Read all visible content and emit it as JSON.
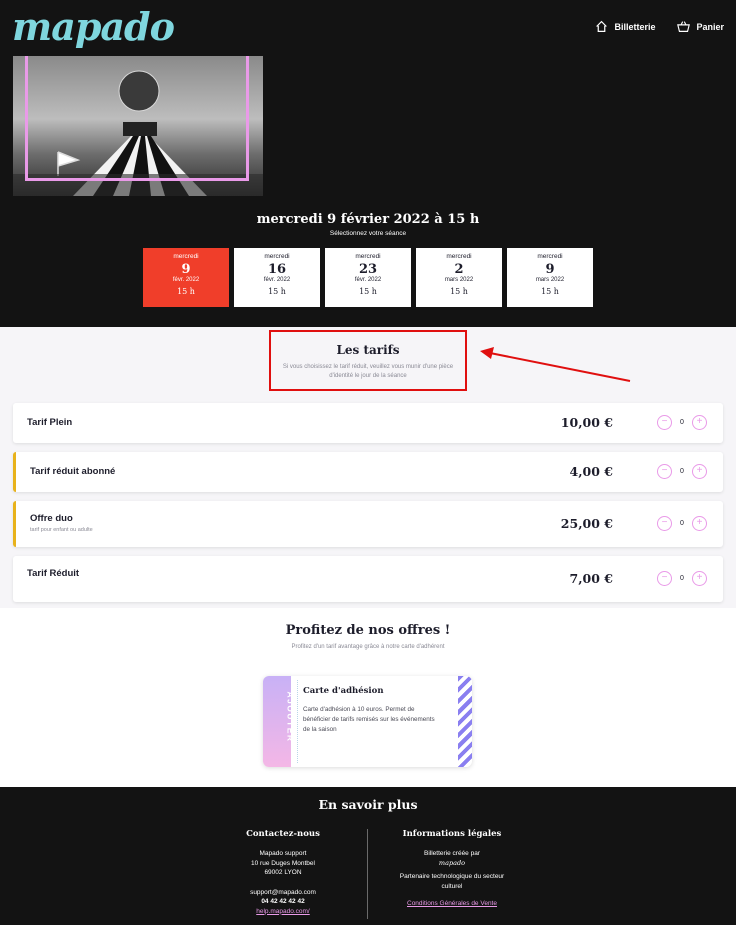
{
  "header": {
    "logo": "mapado",
    "nav": [
      {
        "label": "Billetterie",
        "icon": "home-icon"
      },
      {
        "label": "Panier",
        "icon": "basket-icon"
      }
    ]
  },
  "session": {
    "title": "mercredi 9 février 2022 à 15 h",
    "subtitle": "Sélectionnez votre séance",
    "dates": [
      {
        "dow": "mercredi",
        "day": "9",
        "month": "févr. 2022",
        "hour": "15 h",
        "active": true
      },
      {
        "dow": "mercredi",
        "day": "16",
        "month": "févr. 2022",
        "hour": "15 h",
        "active": false
      },
      {
        "dow": "mercredi",
        "day": "23",
        "month": "févr. 2022",
        "hour": "15 h",
        "active": false
      },
      {
        "dow": "mercredi",
        "day": "2",
        "month": "mars 2022",
        "hour": "15 h",
        "active": false
      },
      {
        "dow": "mercredi",
        "day": "9",
        "month": "mars 2022",
        "hour": "15 h",
        "active": false
      }
    ]
  },
  "tarifs": {
    "title": "Les tarifs",
    "subtitle": "Si vous choisissez le tarif réduit, veuillez vous munir d'une pièce d'identité le jour de la séance",
    "items": [
      {
        "name": "Tarif Plein",
        "desc": "",
        "price": "10,00 €",
        "qty": "0",
        "minus": "−",
        "plus": "+"
      },
      {
        "name": "Tarif réduit abonné",
        "desc": "",
        "price": "4,00 €",
        "qty": "0",
        "minus": "−",
        "plus": "+"
      },
      {
        "name": "Offre duo",
        "desc": "tarif pour enfant ou adulte",
        "price": "25,00 €",
        "qty": "0",
        "minus": "−",
        "plus": "+"
      },
      {
        "name": "Tarif Réduit",
        "desc": "",
        "price": "7,00 €",
        "qty": "0",
        "minus": "−",
        "plus": "+"
      }
    ]
  },
  "offers": {
    "title": "Profitez de nos offres !",
    "subtitle": "Profitez d'un tarif avantage grâce à notre carte d'adhérent",
    "card": {
      "add_label": "AJOUTER",
      "title": "Carte d'adhésion",
      "desc": "Carte d'adhésion à 10 euros. Permet de bénéficier de tarifs remisés sur les événements de la saison"
    }
  },
  "footer": {
    "title": "En savoir plus",
    "contact": {
      "heading": "Contactez-nous",
      "name": "Mapado support",
      "street": "10 rue Duges Montbel",
      "city": "69002 LYON",
      "email": "support@mapado.com",
      "phone": "04 42 42 42 42",
      "help": "help.mapado.com/"
    },
    "legal": {
      "heading": "Informations légales",
      "created_by": "Billetterie créée par",
      "signature": "mapado",
      "partner": "Partenaire technologique du secteur culturel",
      "cgv": "Conditions Générales de Vente"
    }
  },
  "colors": {
    "accent_active": "#f03e2a",
    "pink": "#e99ae8",
    "highlight_box": "#e00f0f",
    "row_accent": "#e8b21b",
    "logo": "#7fd6de"
  }
}
